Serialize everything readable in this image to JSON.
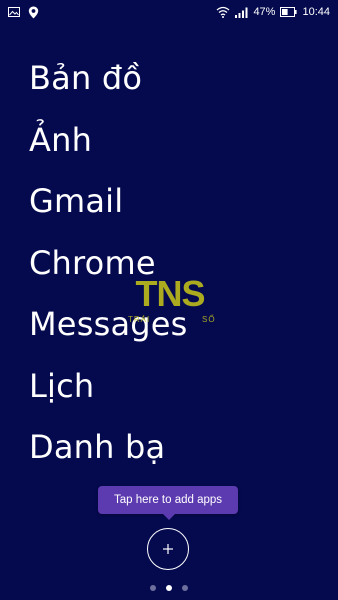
{
  "status_bar": {
    "battery_percent": "47%",
    "time": "10:44",
    "icons": [
      "image-icon",
      "location-icon",
      "wifi-icon",
      "signal-icon",
      "battery-icon"
    ]
  },
  "apps": [
    {
      "label": "Bản đồ"
    },
    {
      "label": "Ảnh"
    },
    {
      "label": "Gmail"
    },
    {
      "label": "Chrome"
    },
    {
      "label": "Messages"
    },
    {
      "label": "Lịch"
    },
    {
      "label": "Danh bạ"
    }
  ],
  "watermark": {
    "logo_text": "TNS",
    "subtext_left": "TRẢI",
    "subtext_right": "SỐ"
  },
  "tooltip": {
    "text": "Tap here to add apps"
  },
  "add_button": {
    "icon": "plus-icon"
  },
  "pagination": {
    "total": 3,
    "active_index": 1
  },
  "colors": {
    "background": "#050a4f",
    "tooltip": "#5c3bb0",
    "watermark": "#c4c21a"
  }
}
